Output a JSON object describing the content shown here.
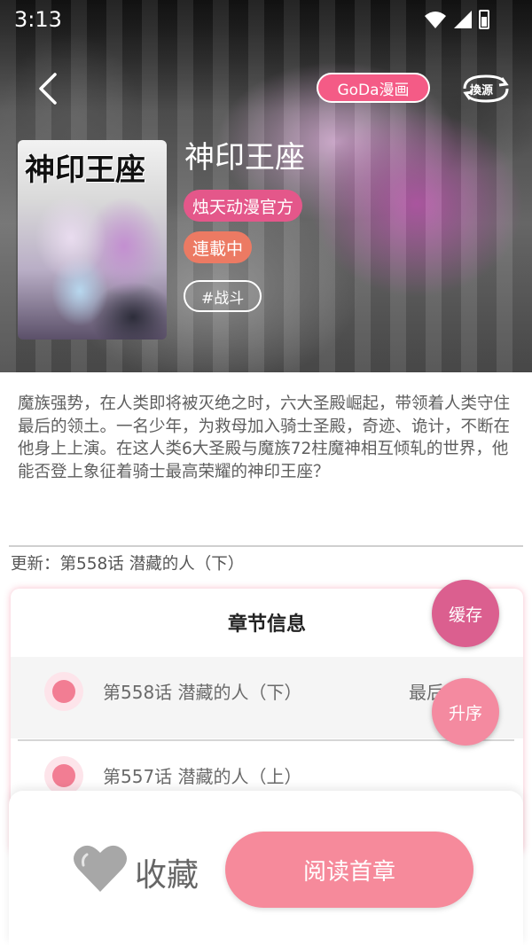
{
  "status_bar": {
    "time": "3:13"
  },
  "header": {
    "source": "GoDa漫画",
    "switch_source_label": "換源"
  },
  "comic": {
    "cover_title": "神印王座",
    "title": "神印王座",
    "author": "烛天动漫官方",
    "status": "連載中",
    "genre": "#战斗",
    "description": "魔族强势，在人类即将被灭绝之时，六大圣殿崛起，带领着人类守住最后的领土。一名少年，为救母加入骑士圣殿，奇迹、诡计，不断在他身上上演。在这人类6大圣殿与魔族72柱魔神相互倾轧的世界，他能否登上象征着骑士最高荣耀的神印王座？",
    "update": "更新：第558话 潜藏的人（下）"
  },
  "chapters": {
    "header": "章节信息",
    "items": [
      {
        "name": "第558话 潜藏的人（下）",
        "tag": "最后一话"
      },
      {
        "name": "第557话 潜藏的人（上）",
        "tag": ""
      }
    ]
  },
  "fabs": {
    "cache": "缓存",
    "sort": "升序"
  },
  "bottom": {
    "favorite": "收藏",
    "read_first": "阅读首章"
  },
  "colors": {
    "accent": "#f45b86",
    "read_button": "#f68a9b",
    "author_chip": "#e4578a",
    "status_chip": "#ec7a63"
  }
}
